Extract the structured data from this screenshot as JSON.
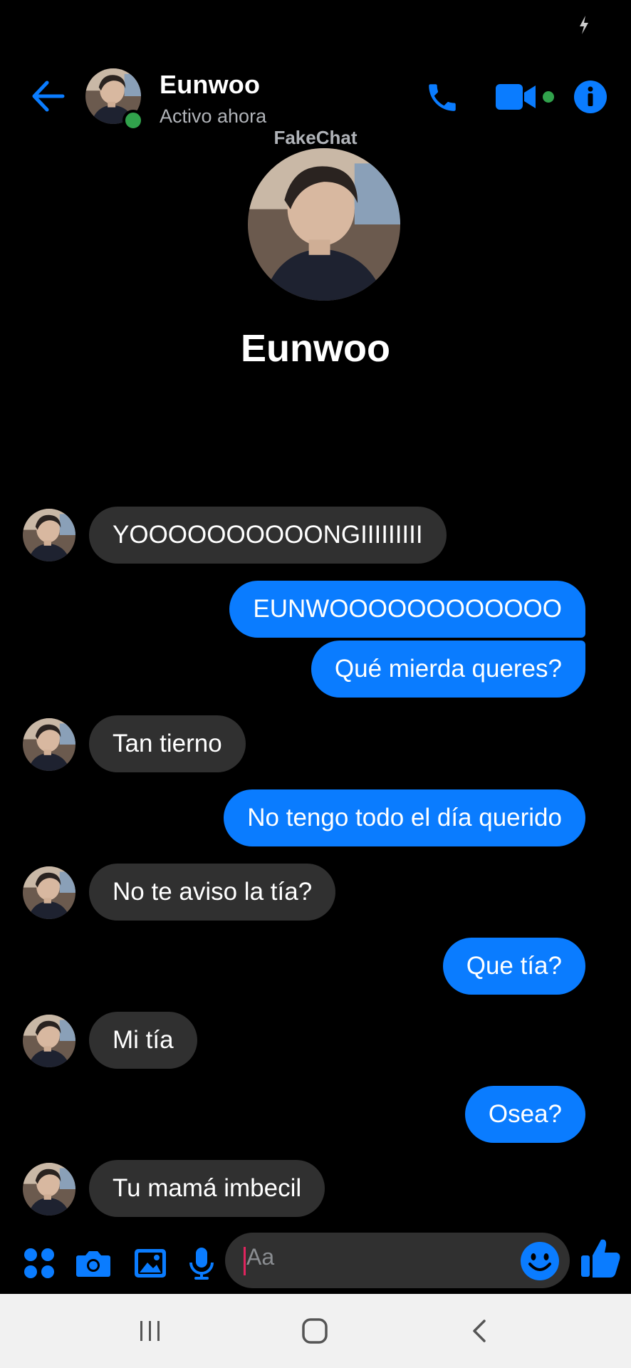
{
  "contact": {
    "name": "Eunwoo",
    "status": "Activo ahora"
  },
  "watermark": "FakeChat",
  "profile": {
    "name": "Eunwoo"
  },
  "messages": [
    {
      "dir": "in",
      "text": "YOOOOOOOOOONGIIIIIIIII"
    },
    {
      "dir": "out",
      "text": "EUNWOOOOOOOOOOOO"
    },
    {
      "dir": "out",
      "text": "Qué mierda queres?"
    },
    {
      "dir": "in",
      "text": "Tan tierno"
    },
    {
      "dir": "out",
      "text": "No tengo todo el día querido"
    },
    {
      "dir": "in",
      "text": "No te aviso la tía?"
    },
    {
      "dir": "out",
      "text": "Que tía?"
    },
    {
      "dir": "in",
      "text": "Mi tía"
    },
    {
      "dir": "out",
      "text": "Osea?"
    },
    {
      "dir": "in",
      "text": "Tu mamá imbecil"
    }
  ],
  "composer": {
    "placeholder": "Aa"
  },
  "colors": {
    "accent": "#0a7cff",
    "incoming_bubble": "#303030",
    "online": "#31a24c",
    "background": "#000000"
  },
  "icons": {
    "status": "lightning-icon",
    "back": "back-arrow-icon",
    "call": "phone-icon",
    "video": "video-camera-icon",
    "info": "info-icon",
    "apps": "four-dots-icon",
    "camera": "camera-icon",
    "gallery": "image-icon",
    "mic": "microphone-icon",
    "emoji": "emoji-icon",
    "like": "thumbs-up-icon",
    "nav_recents": "recents-icon",
    "nav_home": "home-icon",
    "nav_back": "back-chevron-icon"
  }
}
